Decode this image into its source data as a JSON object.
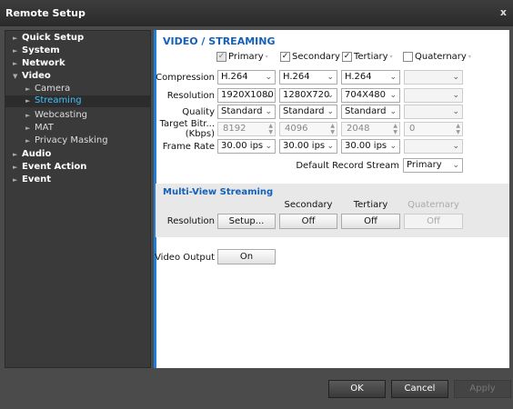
{
  "window": {
    "title": "Remote Setup",
    "close_glyph": "x"
  },
  "sidebar": {
    "items": [
      {
        "label": "Quick Setup"
      },
      {
        "label": "System"
      },
      {
        "label": "Network"
      },
      {
        "label": "Video"
      },
      {
        "label": "Camera"
      },
      {
        "label": "Streaming"
      },
      {
        "label": "Webcasting"
      },
      {
        "label": "MAT"
      },
      {
        "label": "Privacy Masking"
      },
      {
        "label": "Audio"
      },
      {
        "label": "Event Action"
      },
      {
        "label": "Event"
      }
    ]
  },
  "main": {
    "title": "VIDEO / STREAMING",
    "streams": {
      "primary": {
        "label": "Primary",
        "checked": true
      },
      "secondary": {
        "label": "Secondary",
        "checked": true
      },
      "tertiary": {
        "label": "Tertiary",
        "checked": true
      },
      "quaternary": {
        "label": "Quaternary",
        "checked": false
      }
    },
    "labels": {
      "compression": "Compression",
      "resolution": "Resolution",
      "quality": "Quality",
      "target_bitrate": "Target Bitr... (Kbps)",
      "frame_rate": "Frame Rate",
      "default_record_stream": "Default Record Stream"
    },
    "compression": [
      "H.264",
      "H.264",
      "H.264",
      ""
    ],
    "resolution": [
      "1920X1080",
      "1280X720",
      "704X480",
      ""
    ],
    "quality": [
      "Standard",
      "Standard",
      "Standard",
      ""
    ],
    "bitrate": [
      "8192",
      "4096",
      "2048",
      "0"
    ],
    "frame_rate": [
      "30.00 ips",
      "30.00 ips",
      "30.00 ips",
      ""
    ],
    "default_record_stream": "Primary"
  },
  "multiview": {
    "title": "Multi-View Streaming",
    "headers": [
      "Secondary",
      "Tertiary",
      "Quaternary"
    ],
    "resolution_label": "Resolution",
    "setup_button": "Setup...",
    "values": [
      "Off",
      "Off",
      "Off"
    ]
  },
  "video_output": {
    "label": "Video Output",
    "value": "On"
  },
  "footer": {
    "ok": "OK",
    "cancel": "Cancel",
    "apply": "Apply"
  },
  "colors": {
    "accent": "#1f7fd8",
    "selected_text": "#3fc0ff",
    "heading": "#1560b8"
  }
}
